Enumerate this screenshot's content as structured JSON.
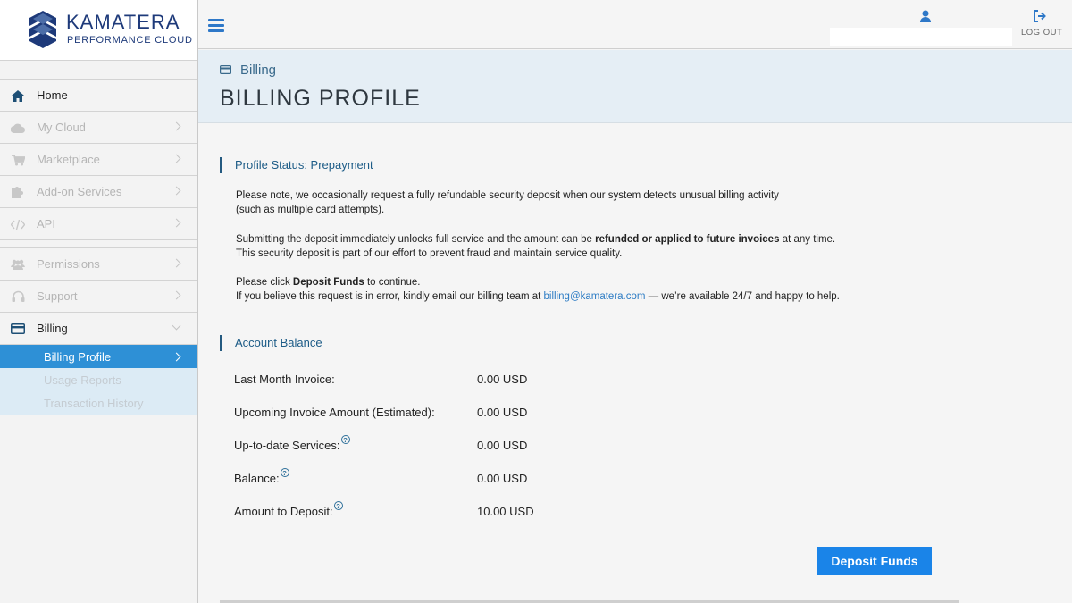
{
  "brand": {
    "name": "KAMATERA",
    "tagline": "PERFORMANCE CLOUD"
  },
  "topbar": {
    "logout_label": "LOG OUT"
  },
  "sidebar": {
    "items": [
      {
        "label": "Home",
        "icon": "home-icon",
        "active": true
      },
      {
        "label": "My Cloud",
        "icon": "cloud-icon"
      },
      {
        "label": "Marketplace",
        "icon": "cart-icon"
      },
      {
        "label": "Add-on Services",
        "icon": "puzzle-icon"
      },
      {
        "label": "API",
        "icon": "code-icon"
      },
      {
        "label": "Permissions",
        "icon": "users-icon"
      },
      {
        "label": "Support",
        "icon": "headset-icon"
      },
      {
        "label": "Billing",
        "icon": "credit-card-icon",
        "active": true,
        "expanded": true
      }
    ],
    "billing_sub": [
      {
        "label": "Billing Profile",
        "selected": true
      },
      {
        "label": "Usage Reports"
      },
      {
        "label": "Transaction History"
      }
    ]
  },
  "page": {
    "breadcrumb": "Billing",
    "title": "BILLING PROFILE"
  },
  "profile": {
    "heading": "Profile Status: Prepayment",
    "p1_line1": "Please note, we occasionally request a fully refundable security deposit when our system detects unusual billing activity",
    "p1_line2": "(such as multiple card attempts).",
    "p2_pre": "Submitting the deposit immediately unlocks full service and the amount can be ",
    "p2_bold": "refunded or applied to future invoices",
    "p2_post": " at any time.",
    "p2_line2": "This security deposit is part of our effort to prevent fraud and maintain service quality.",
    "p3_pre": "Please click ",
    "p3_bold": "Deposit Funds",
    "p3_post": " to continue.",
    "p3_line2_pre": "If you believe this request is in error, kindly email our billing team at ",
    "p3_email": "billing@kamatera.com",
    "p3_line2_post": " — we’re available 24/7 and happy to help."
  },
  "balance": {
    "heading": "Account Balance",
    "rows": [
      {
        "label": "Last Month Invoice:",
        "value": "0.00 USD",
        "help": false
      },
      {
        "label": "Upcoming Invoice Amount (Estimated):",
        "value": "0.00 USD",
        "help": false
      },
      {
        "label": "Up-to-date Services:",
        "value": "0.00 USD",
        "help": true
      },
      {
        "label": "Balance:",
        "value": "0.00 USD",
        "help": true
      },
      {
        "label": "Amount to Deposit:",
        "value": "10.00 USD",
        "help": true
      }
    ],
    "help_glyph": "?"
  },
  "actions": {
    "deposit_label": "Deposit Funds"
  },
  "colors": {
    "accent": "#1a84e8",
    "brand": "#1e3a7a",
    "selected_nav": "#2e90d6",
    "heading": "#1d5c87"
  }
}
